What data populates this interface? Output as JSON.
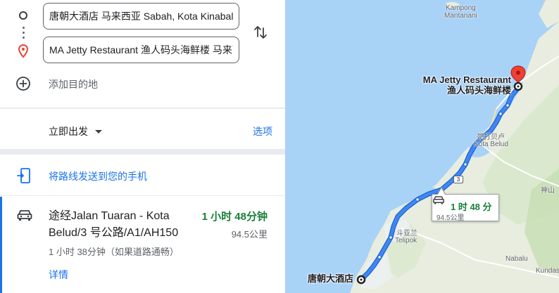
{
  "directions": {
    "origin": {
      "value": "唐朝大酒店 马来西亚 Sabah, Kota Kinabalu"
    },
    "destination": {
      "value": "MA Jetty Restaurant 渔人码头海鲜楼 马来西亚"
    },
    "add_destination_label": "添加目的地",
    "depart_now_label": "立即出发",
    "options_label": "选项",
    "send_to_phone_label": "将路线发送到您的手机"
  },
  "route": {
    "title": "途经Jalan Tuaran - Kota Belud/3 号公路/A1/AH150",
    "duration": "1 小时 48分钟",
    "distance": "94.5公里",
    "typical": "1 小时 38分钟（如果道路通畅）",
    "details_label": "详情"
  },
  "map": {
    "labels": {
      "kampong_line1": "Kampong",
      "kampong_line2": "Mantanani",
      "kota_belud_cn": "哥打贝卢",
      "kota_belud": "Kota Belud",
      "tuaran_cn": "斗亚兰",
      "telipok": "Telipok",
      "shenshan": "神山",
      "nabalu": "Nabalu",
      "kundasang": "Kundasa",
      "dest_line1": "MA Jetty Restaurant",
      "dest_line2": "渔人码头海鲜楼",
      "origin_label": "唐朝大酒店"
    },
    "highway_shield": "3",
    "callout": {
      "time": "1 时 48 分",
      "distance": "94.5公里"
    }
  },
  "colors": {
    "accent_blue": "#1a73e8",
    "route_blue": "#1a73e8",
    "duration_green": "#188038",
    "water": "#a9d2f7",
    "land": "#e8eddf",
    "pin_red": "#ea4335"
  },
  "icons": [
    "origin-circle-icon",
    "route-dots-icon",
    "destination-pin-icon",
    "swap-icon",
    "add-circle-icon",
    "dropdown-arrow-icon",
    "send-to-phone-icon",
    "car-icon",
    "map-pin-icon"
  ]
}
